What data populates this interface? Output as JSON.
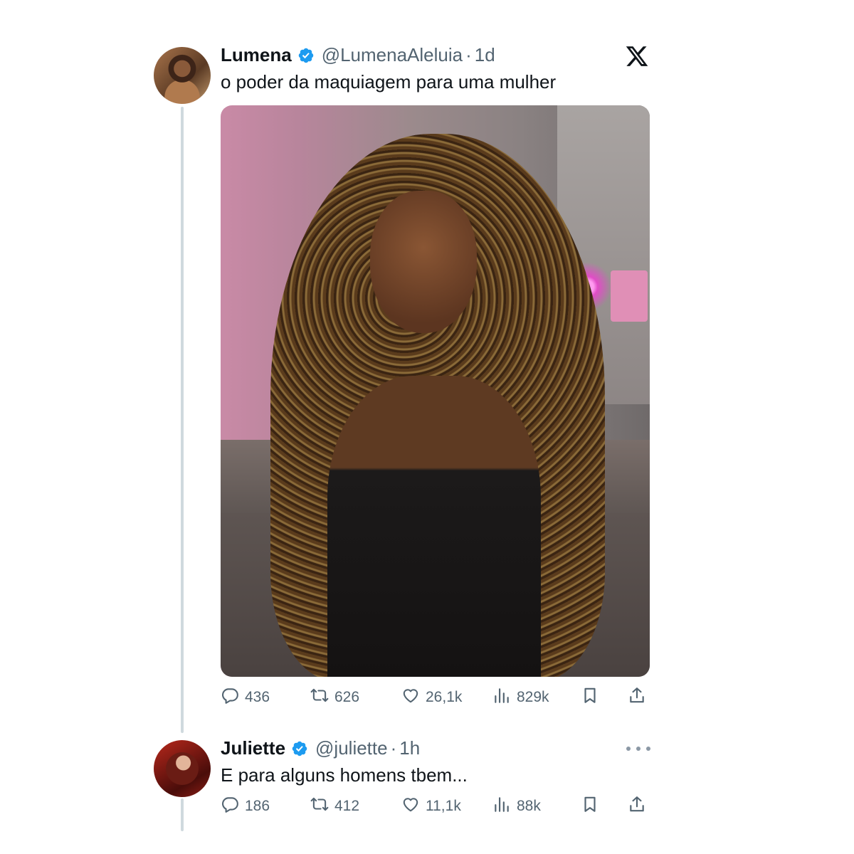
{
  "tweet": {
    "name": "Lumena",
    "handle": "@LumenaAleluia",
    "separator": "·",
    "time": "1d",
    "text": "o poder da maquiagem para uma mulher",
    "stats": {
      "replies": "436",
      "retweets": "626",
      "likes": "26,1k",
      "views": "829k"
    }
  },
  "reply": {
    "name": "Juliette",
    "handle": "@juliette",
    "separator": "·",
    "time": "1h",
    "text": "E para alguns homens tbem...",
    "stats": {
      "replies": "186",
      "retweets": "412",
      "likes": "11,1k",
      "views": "88k"
    }
  },
  "icons": {
    "brand": "x-logo-icon",
    "verified": "verified-badge-icon",
    "reply": "reply-icon",
    "retweet": "retweet-icon",
    "like": "heart-icon",
    "views": "views-icon",
    "bookmark": "bookmark-icon",
    "share": "share-icon",
    "more": "more-icon"
  },
  "colors": {
    "verified": "#1d9bf0",
    "text": "#0f1419",
    "secondary": "#536471",
    "thread_line": "#cfd9de"
  }
}
